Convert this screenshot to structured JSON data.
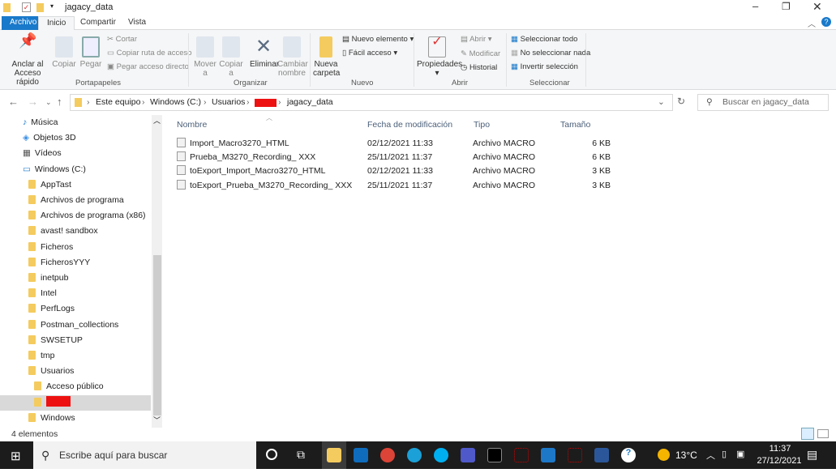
{
  "window": {
    "title": "jagacy_data"
  },
  "tabs": [
    {
      "label": "Archivo"
    },
    {
      "label": "Inicio"
    },
    {
      "label": "Compartir"
    },
    {
      "label": "Vista"
    }
  ],
  "ribbon": {
    "pin": "Anclar al Acceso rápido",
    "copy": "Copiar",
    "paste": "Pegar",
    "cut": "Cortar",
    "copy_path": "Copiar ruta de acceso",
    "paste_shortcut": "Pegar acceso directo",
    "group_clipboard": "Portapapeles",
    "move": "Mover a",
    "copy_to": "Copiar a",
    "delete": "Eliminar",
    "rename": "Cambiar nombre",
    "group_organize": "Organizar",
    "new_folder": "Nueva carpeta",
    "new_item": "Nuevo elemento",
    "easy_access": "Fácil acceso",
    "group_new": "Nuevo",
    "properties": "Propiedades",
    "open": "Abrir",
    "edit": "Modificar",
    "history": "Historial",
    "group_open": "Abrir",
    "select_all": "Seleccionar todo",
    "select_none": "No seleccionar nada",
    "invert": "Invertir selección",
    "group_select": "Seleccionar"
  },
  "address": {
    "crumbs": [
      "Este equipo",
      "Windows (C:)",
      "Usuarios",
      "jagacy_data"
    ],
    "search_placeholder": "Buscar en jagacy_data",
    "redacted_color": "#ee1111"
  },
  "tree": [
    {
      "label": "Música",
      "indent": 1
    },
    {
      "label": "Objetos 3D",
      "indent": 1
    },
    {
      "label": "Vídeos",
      "indent": 1
    },
    {
      "label": "Windows  (C:)",
      "indent": 1
    },
    {
      "label": "AppTast",
      "indent": 2
    },
    {
      "label": "Archivos de programa",
      "indent": 2
    },
    {
      "label": "Archivos de programa (x86)",
      "indent": 2
    },
    {
      "label": "avast! sandbox",
      "indent": 2
    },
    {
      "label": "Ficheros",
      "indent": 2
    },
    {
      "label": "FicherosYYY",
      "indent": 2
    },
    {
      "label": "inetpub",
      "indent": 2
    },
    {
      "label": "Intel",
      "indent": 2
    },
    {
      "label": "PerfLogs",
      "indent": 2
    },
    {
      "label": "Postman_collections",
      "indent": 2
    },
    {
      "label": "SWSETUP",
      "indent": 2
    },
    {
      "label": "tmp",
      "indent": 2
    },
    {
      "label": "Usuarios",
      "indent": 2
    },
    {
      "label": "Acceso público",
      "indent": 3
    },
    {
      "label": "",
      "indent": 3
    },
    {
      "label": "Windows",
      "indent": 2
    }
  ],
  "columns": [
    "Nombre",
    "Fecha de modificación",
    "Tipo",
    "Tamaño"
  ],
  "files": [
    {
      "name": "Import_Macro3270_HTML",
      "date": "02/12/2021 11:33",
      "type": "Archivo MACRO",
      "size": "6 KB"
    },
    {
      "name": "Prueba_M3270_Recording_  XXX",
      "date": "25/11/2021 11:37",
      "type": "Archivo MACRO",
      "size": "6 KB"
    },
    {
      "name": "toExport_Import_Macro3270_HTML",
      "date": "02/12/2021 11:33",
      "type": "Archivo MACRO",
      "size": "3 KB"
    },
    {
      "name": "toExport_Prueba_M3270_Recording_  XXX",
      "date": "25/11/2021 11:37",
      "type": "Archivo MACRO",
      "size": "3 KB"
    }
  ],
  "status": "4 elementos",
  "taskbar": {
    "search": "Escribe aquí para buscar",
    "weather": "13°C",
    "time": "11:37",
    "date": "27/12/2021"
  }
}
